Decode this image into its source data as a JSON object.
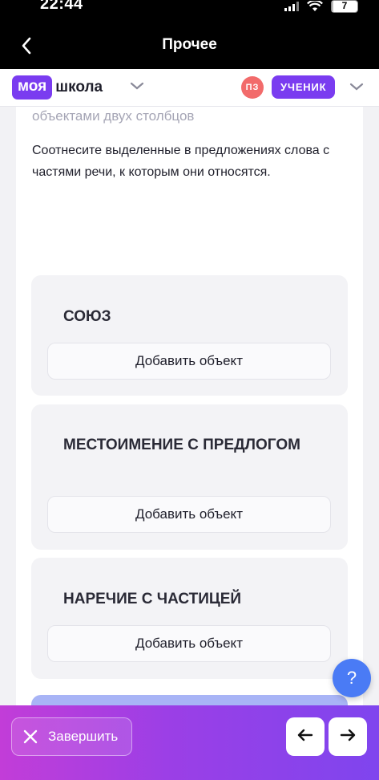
{
  "status_bar": {
    "time": "22:44",
    "battery": "7",
    "battery_level": 0.07
  },
  "nav": {
    "title": "Прочее",
    "back_icon": "chevron-left-icon"
  },
  "header": {
    "logo_badge": "моя",
    "logo_text": "школа",
    "logo_chevron": "chevron-down-icon",
    "avatar_initials": "ПЗ",
    "role": "УЧЕНИК",
    "role_chevron": "chevron-down-icon",
    "colors": {
      "brand": "#7a3cf0",
      "avatar": "#f26b6b"
    }
  },
  "question": {
    "subtitle": "объектами двух столбцов",
    "text": "Соотнесите выделенные в предложениях слова с частями речи, к которым они относятся."
  },
  "cards": [
    {
      "title": "СОЮЗ",
      "button": "Добавить объект"
    },
    {
      "title": "МЕСТОИМЕНИЕ С ПРЕДЛОГОМ",
      "button": "Добавить объект"
    },
    {
      "title": "НАРЕЧИЕ С ЧАСТИЦЕЙ",
      "button": "Добавить объект"
    }
  ],
  "help": {
    "label": "?"
  },
  "footer": {
    "finish_label": "Завершить",
    "finish_icon": "close-icon",
    "prev_icon": "arrow-left-icon",
    "next_icon": "arrow-right-icon"
  }
}
